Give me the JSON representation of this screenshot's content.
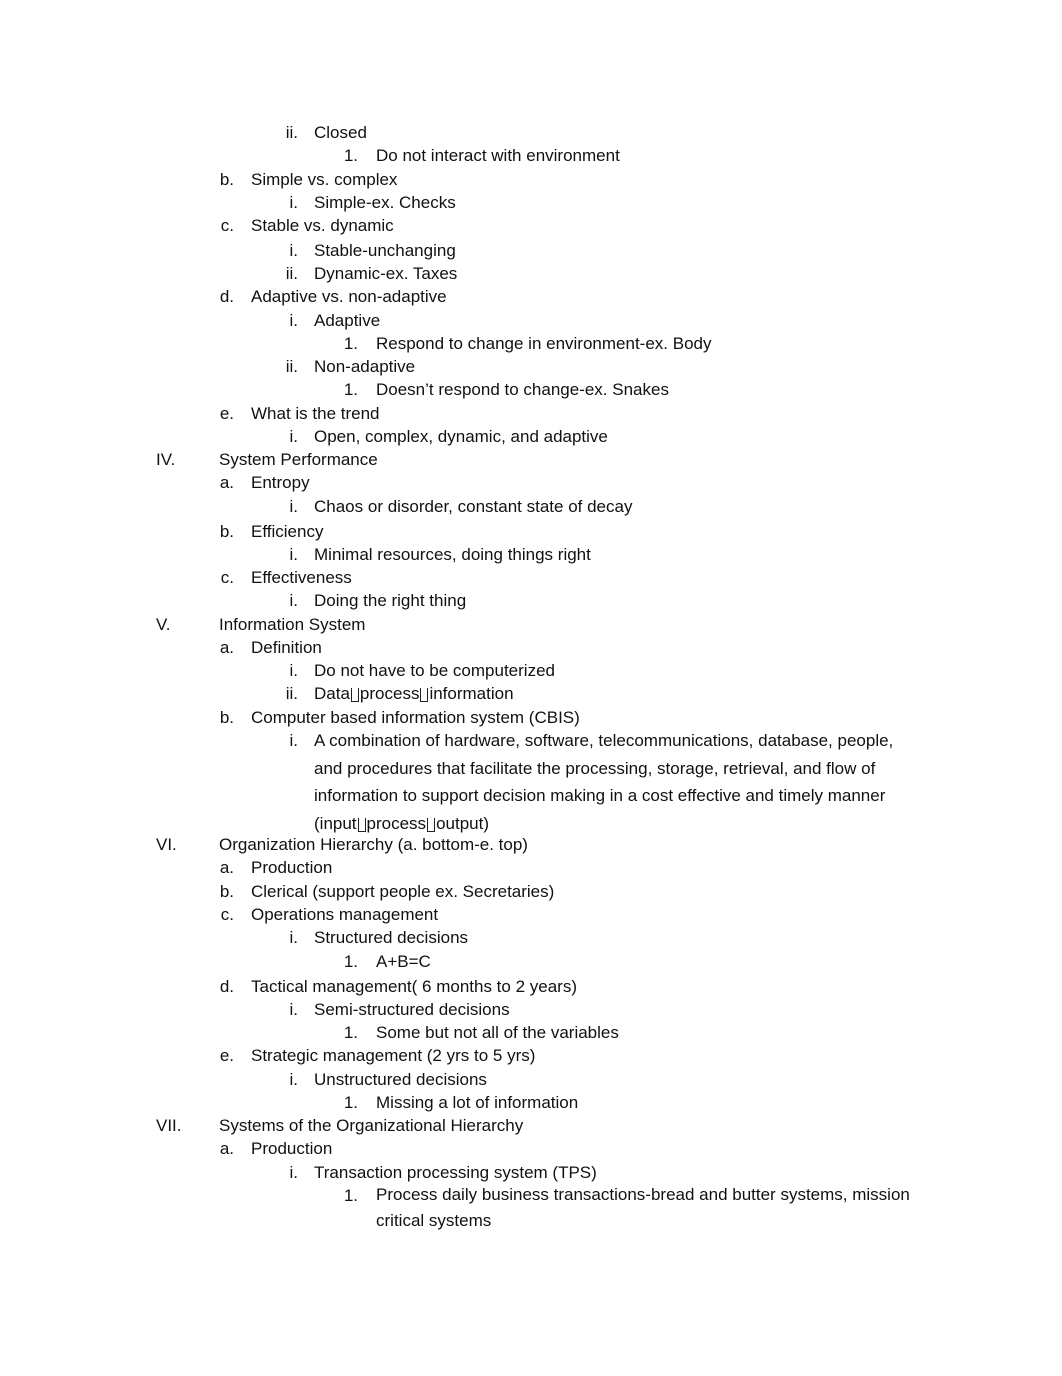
{
  "document": {
    "items": [
      {
        "level": 3,
        "marker": "ii.",
        "text": "Closed"
      },
      {
        "level": 4,
        "marker": "1.",
        "text": "Do not interact with environment"
      },
      {
        "level": 2,
        "marker": "b.",
        "text": "Simple vs. complex"
      },
      {
        "level": 3,
        "marker": "i.",
        "text": "Simple-ex. Checks"
      },
      {
        "level": 2,
        "marker": "c.",
        "text": "Stable vs. dynamic"
      },
      {
        "level": 3,
        "marker": "i.",
        "text": "Stable-unchanging"
      },
      {
        "level": 3,
        "marker": "ii.",
        "text": "Dynamic-ex. Taxes"
      },
      {
        "level": 2,
        "marker": "d.",
        "text": "Adaptive vs. non-adaptive"
      },
      {
        "level": 3,
        "marker": "i.",
        "text": "Adaptive"
      },
      {
        "level": 4,
        "marker": "1.",
        "text": "Respond to change in environment-ex. Body"
      },
      {
        "level": 3,
        "marker": "ii.",
        "text": "Non-adaptive"
      },
      {
        "level": 4,
        "marker": "1.",
        "text": "Doesn’t respond to change-ex. Snakes"
      },
      {
        "level": 2,
        "marker": "e.",
        "text": "What is the trend"
      },
      {
        "level": 3,
        "marker": "i.",
        "text": "Open, complex, dynamic, and adaptive"
      },
      {
        "level": 1,
        "marker": "IV.",
        "text": "System Performance"
      },
      {
        "level": 2,
        "marker": "a.",
        "text": "Entropy"
      },
      {
        "level": 3,
        "marker": "i.",
        "text": "Chaos or disorder, constant state of decay"
      },
      {
        "level": 2,
        "marker": "b.",
        "text": "Efficiency"
      },
      {
        "level": 3,
        "marker": "i.",
        "text": "Minimal resources, doing things right"
      },
      {
        "level": 2,
        "marker": "c.",
        "text": "Effectiveness"
      },
      {
        "level": 3,
        "marker": "i.",
        "text": "Doing the right thing"
      },
      {
        "level": 1,
        "marker": "V.",
        "text": "Information System"
      },
      {
        "level": 2,
        "marker": "a.",
        "text": "Definition"
      },
      {
        "level": 3,
        "marker": "i.",
        "text": "Do not have to be computerized"
      },
      {
        "level": 3,
        "marker": "ii.",
        "text": "Data□process□information"
      },
      {
        "level": 2,
        "marker": "b.",
        "text": "Computer based information system (CBIS)"
      },
      {
        "level": 3,
        "marker": "i.",
        "text": "A combination of hardware, software, telecommunications, database, people, and procedures that facilitate the processing, storage, retrieval, and flow of information to support decision making in a cost effective and timely manner (input□process□output)"
      },
      {
        "level": 1,
        "marker": "VI.",
        "text": "Organization Hierarchy (a. bottom-e. top)"
      },
      {
        "level": 2,
        "marker": "a.",
        "text": "Production"
      },
      {
        "level": 2,
        "marker": "b.",
        "text": "Clerical (support people ex. Secretaries)"
      },
      {
        "level": 2,
        "marker": "c.",
        "text": "Operations management"
      },
      {
        "level": 3,
        "marker": "i.",
        "text": "Structured decisions"
      },
      {
        "level": 4,
        "marker": "1.",
        "text": "A+B=C"
      },
      {
        "level": 2,
        "marker": "d.",
        "text": "Tactical management( 6 months to 2 years)"
      },
      {
        "level": 3,
        "marker": "i.",
        "text": "Semi-structured decisions"
      },
      {
        "level": 4,
        "marker": "1.",
        "text": "Some but not all of the variables"
      },
      {
        "level": 2,
        "marker": "e.",
        "text": "Strategic management (2 yrs to 5 yrs)"
      },
      {
        "level": 3,
        "marker": "i.",
        "text": "Unstructured decisions"
      },
      {
        "level": 4,
        "marker": "1.",
        "text": "Missing a lot of information"
      },
      {
        "level": 1,
        "marker": "VII.",
        "text": "Systems of the Organizational Hierarchy"
      },
      {
        "level": 2,
        "marker": "a.",
        "text": "Production"
      },
      {
        "level": 3,
        "marker": "i.",
        "text": "Transaction processing system (TPS)"
      },
      {
        "level": 4,
        "marker": "1.",
        "text": "Process daily business transactions-bread and butter systems, mission critical systems"
      }
    ]
  }
}
